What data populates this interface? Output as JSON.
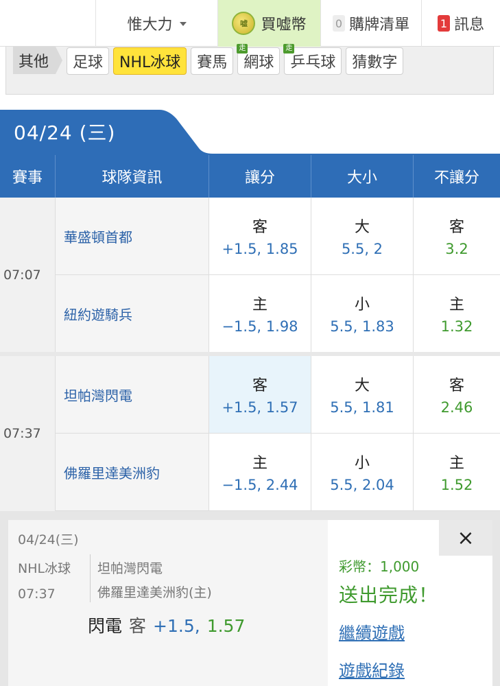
{
  "topbar": {
    "user_label": "惟大力",
    "buy_label": "買嘘幣",
    "coin_glyph": "嘘",
    "cart_count": "0",
    "cart_label": "購牌清單",
    "msg_count": "1",
    "msg_label": "訊息"
  },
  "categories": {
    "first": "其他",
    "items": [
      {
        "label": "足球",
        "live": ""
      },
      {
        "label": "NHL冰球",
        "live": ""
      },
      {
        "label": "賽馬",
        "live": ""
      },
      {
        "label": "網球",
        "live": "走"
      },
      {
        "label": "乒乓球",
        "live": "走"
      },
      {
        "label": "猜數字",
        "live": ""
      }
    ]
  },
  "date_tab": "04/24 (三)",
  "table": {
    "headers": [
      "賽事",
      "球隊資訊",
      "讓分",
      "大小",
      "不讓分"
    ]
  },
  "games": [
    {
      "time": "07:07",
      "rows": [
        {
          "team": "華盛頓首都",
          "spread_label": "客",
          "spread_val": "+1.5, 1.85",
          "total_label": "大",
          "total_val": "5.5, 2",
          "ml_label": "客",
          "ml_val": "3.2"
        },
        {
          "team": "紐約遊騎兵",
          "spread_label": "主",
          "spread_val": "−1.5, 1.98",
          "total_label": "小",
          "total_val": "5.5, 1.83",
          "ml_label": "主",
          "ml_val": "1.32"
        }
      ]
    },
    {
      "time": "07:37",
      "rows": [
        {
          "team": "坦帕灣閃電",
          "spread_label": "客",
          "spread_val": "+1.5, 1.57",
          "total_label": "大",
          "total_val": "5.5, 1.81",
          "ml_label": "客",
          "ml_val": "2.46"
        },
        {
          "team": "佛羅里達美洲豹",
          "spread_label": "主",
          "spread_val": "−1.5, 2.44",
          "total_label": "小",
          "total_val": "5.5, 2.04",
          "ml_label": "主",
          "ml_val": "1.52"
        }
      ]
    }
  ],
  "popup": {
    "date": "04/24(三)",
    "league": "NHL冰球",
    "time": "07:37",
    "home": "坦帕灣閃電",
    "away": "佛羅里達美洲豹(主)",
    "pick_name": "閃電",
    "pick_side": "客",
    "pick_spread": "+1.5,",
    "pick_odds": "1.57",
    "coins": "彩幣：1,000",
    "done": "送出完成！",
    "continue": "繼續遊戲",
    "history": "遊戲紀錄",
    "close": "×"
  }
}
